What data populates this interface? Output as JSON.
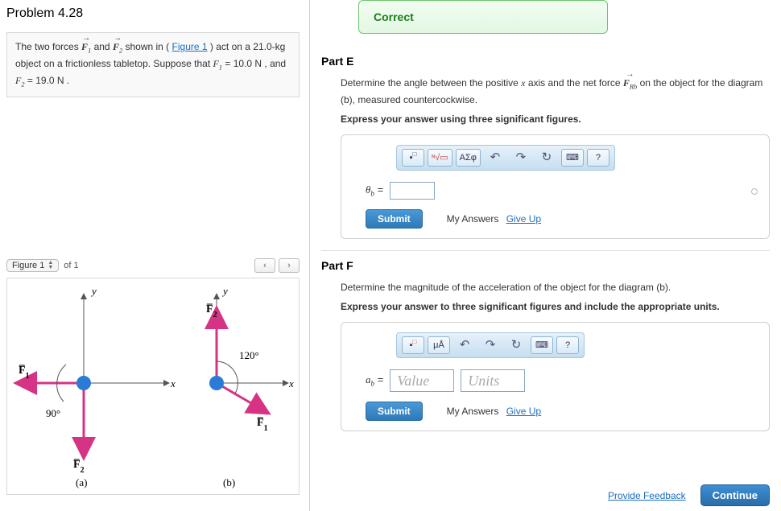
{
  "problem": {
    "title": "Problem 4.28",
    "text_pre": "The two forces ",
    "F1": "F₁",
    "and": " and ",
    "F2": "F₂",
    "text_mid": " shown in (",
    "figlink": "Figure 1",
    "text_post1": ") act on a 21.0-kg object on a frictionless tabletop. Suppose that ",
    "F1v": "F₁",
    "eq1": " = 10.0  N , and ",
    "F2v": "F₂",
    "eq2": " = 19.0  N ."
  },
  "figure": {
    "label": "Figure 1",
    "of": "of 1",
    "prev": "‹",
    "next": "›"
  },
  "correct": {
    "label": "Correct"
  },
  "partE": {
    "head": "Part E",
    "q1": "Determine the angle between the positive ",
    "xvar": "x",
    "q2": " axis and the net force ",
    "FRb": "F",
    "FRb_sub": "Rb",
    "q3": " on the object for the diagram (b), measured countercockwise.",
    "instr": "Express your answer using three significant figures.",
    "var": "θ",
    "var_sub": "b",
    "eq": " = ",
    "submit": "Submit",
    "myans": "My Answers",
    "giveup": "Give Up"
  },
  "partF": {
    "head": "Part F",
    "q": "Determine the magnitude of the acceleration of the object for the diagram (b).",
    "instr": "Express your answer to three significant figures and include the appropriate units.",
    "var": "a",
    "var_sub": "b",
    "eq": " = ",
    "value_ph": "Value",
    "units_ph": "Units",
    "submit": "Submit",
    "myans": "My Answers",
    "giveup": "Give Up"
  },
  "toolbar": {
    "t1": "▪",
    "t2": "√",
    "t3": "ΑΣφ",
    "undo": "↶",
    "redo": "↷",
    "reset": "↻",
    "kb": "⌨",
    "help": "?",
    "tf1": "▪",
    "tf2": "μÅ"
  },
  "footer": {
    "feedback": "Provide Feedback",
    "cont": "Continue"
  },
  "diagram": {
    "y": "y",
    "x": "x",
    "F1": "F₁",
    "F2": "F₂",
    "ang_a": "90°",
    "ang_b": "120°",
    "lab_a": "(a)",
    "lab_b": "(b)"
  }
}
